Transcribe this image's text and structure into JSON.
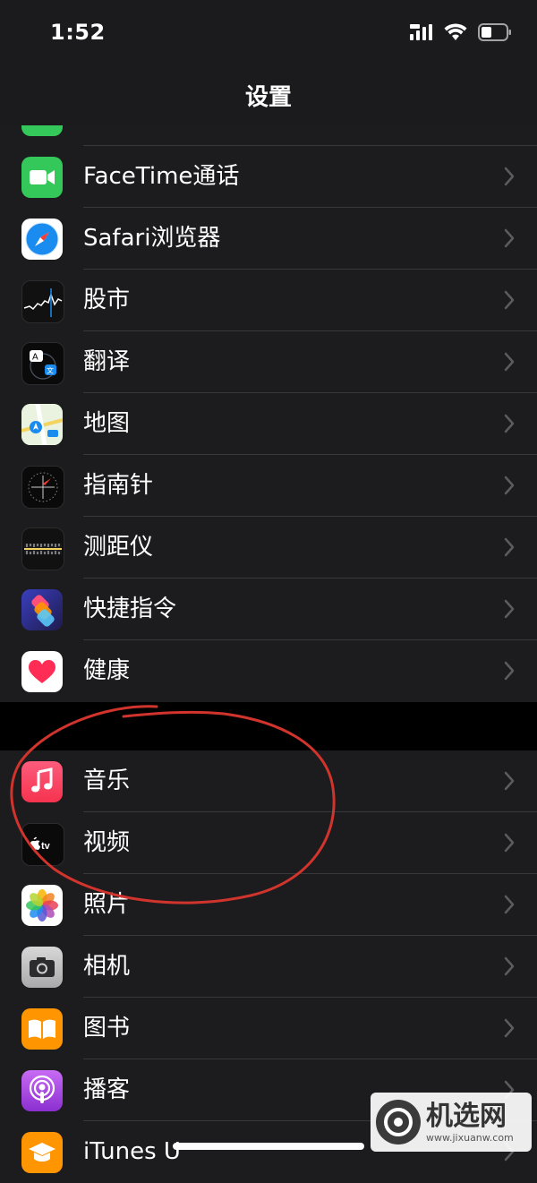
{
  "status_bar": {
    "time": "1:52"
  },
  "nav": {
    "title": "设置"
  },
  "group1": [
    {
      "label": "FaceTime通话",
      "icon": "facetime-icon"
    },
    {
      "label": "Safari浏览器",
      "icon": "safari-icon"
    },
    {
      "label": "股市",
      "icon": "stocks-icon"
    },
    {
      "label": "翻译",
      "icon": "translate-icon"
    },
    {
      "label": "地图",
      "icon": "maps-icon"
    },
    {
      "label": "指南针",
      "icon": "compass-icon"
    },
    {
      "label": "测距仪",
      "icon": "measure-icon"
    },
    {
      "label": "快捷指令",
      "icon": "shortcuts-icon"
    },
    {
      "label": "健康",
      "icon": "health-icon"
    }
  ],
  "group2": [
    {
      "label": "音乐",
      "icon": "music-icon"
    },
    {
      "label": "视频",
      "icon": "tv-icon"
    },
    {
      "label": "照片",
      "icon": "photos-icon"
    },
    {
      "label": "相机",
      "icon": "camera-icon"
    },
    {
      "label": "图书",
      "icon": "books-icon"
    },
    {
      "label": "播客",
      "icon": "podcasts-icon"
    },
    {
      "label": "iTunes U",
      "icon": "itunes-u-icon"
    }
  ],
  "watermark": {
    "title": "机选网",
    "url": "www.jixuanw.com"
  },
  "colors": {
    "annotation": "#d0342c",
    "background": "#1c1c1e",
    "accent_green": "#34c759"
  }
}
